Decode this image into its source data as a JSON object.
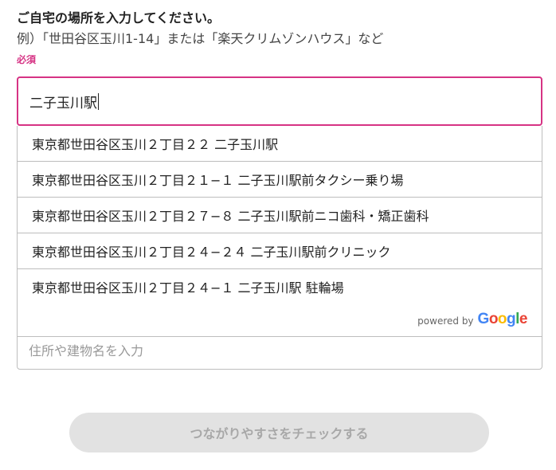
{
  "form": {
    "title": "ご自宅の場所を入力してください。",
    "example": "例）「世田谷区玉川1-14」または「楽天クリムゾンハウス」など",
    "required": "必須",
    "address_value": "二子玉川駅",
    "building_placeholder": "住所や建物名を入力",
    "submit_label": "つながりやすさをチェックする"
  },
  "suggestions": [
    "東京都世田谷区玉川２丁目２２ 二子玉川駅",
    "東京都世田谷区玉川２丁目２１−１ 二子玉川駅前タクシー乗り場",
    "東京都世田谷区玉川２丁目２７−８ 二子玉川駅前ニコ歯科・矯正歯科",
    "東京都世田谷区玉川２丁目２４−２４ 二子玉川駅前クリニック",
    "東京都世田谷区玉川２丁目２４−１ 二子玉川駅 駐輪場"
  ],
  "attribution": {
    "powered_by": "powered by",
    "logo_letters": [
      "G",
      "o",
      "o",
      "g",
      "l",
      "e"
    ]
  },
  "colors": {
    "accent": "#d63384",
    "button_bg": "#e2e2e2",
    "button_text": "#a8a8a8"
  }
}
